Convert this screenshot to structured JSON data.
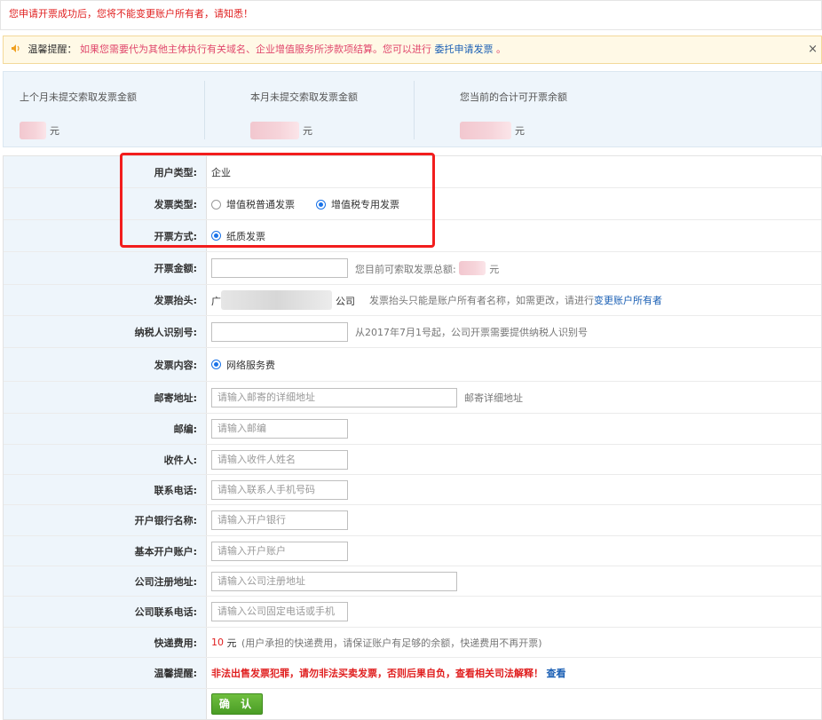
{
  "top_notice": "您申请开票成功后，您将不能变更账户所有者，请知悉！",
  "tip": {
    "title": "温馨提醒：",
    "text": "如果您需要代为其他主体执行有关域名、企业增值服务所涉款项结算。您可以进行",
    "link": "委托申请发票",
    "end": "。",
    "close": "×"
  },
  "summary": {
    "last_month_label": "上个月未提交索取发票金额",
    "this_month_label": "本月未提交索取发票金额",
    "available_label": "您当前的合计可开票余额",
    "unit": "元"
  },
  "form": {
    "user_type": {
      "label": "用户类型:",
      "value": "企业"
    },
    "invoice_type": {
      "label": "发票类型:",
      "options": [
        "增值税普通发票",
        "增值税专用发票"
      ],
      "selected": "增值税专用发票"
    },
    "issue_method": {
      "label": "开票方式:",
      "option": "纸质发票"
    },
    "amount": {
      "label": "开票金额:",
      "hint_prefix": "您目前可索取发票总额:",
      "unit": "元"
    },
    "title": {
      "label": "发票抬头:",
      "value_start": "广",
      "value_end": "公司",
      "hint": "发票抬头只能是账户所有者名称，如需更改，请进行",
      "link": "变更账户所有者"
    },
    "tax_id": {
      "label": "纳税人识别号:",
      "hint": "从2017年7月1号起，公司开票需要提供纳税人识别号"
    },
    "content": {
      "label": "发票内容:",
      "option": "网络服务费"
    },
    "mail_address": {
      "label": "邮寄地址:",
      "placeholder": "请输入邮寄的详细地址",
      "hint": "邮寄详细地址"
    },
    "postcode": {
      "label": "邮编:",
      "placeholder": "请输入邮编"
    },
    "recipient": {
      "label": "收件人:",
      "placeholder": "请输入收件人姓名"
    },
    "phone": {
      "label": "联系电话:",
      "placeholder": "请输入联系人手机号码"
    },
    "bank_name": {
      "label": "开户银行名称:",
      "placeholder": "请输入开户银行"
    },
    "bank_account": {
      "label": "基本开户账户:",
      "placeholder": "请输入开户账户"
    },
    "company_address": {
      "label": "公司注册地址:",
      "placeholder": "请输入公司注册地址"
    },
    "company_phone": {
      "label": "公司联系电话:",
      "placeholder": "请输入公司固定电话或手机"
    },
    "shipping": {
      "label": "快递费用:",
      "amount": "10",
      "unit": "元",
      "note": "(用户承担的快递费用，请保证账户有足够的余额，快递费用不再开票)"
    },
    "warning": {
      "label": "温馨提醒:",
      "text": "非法出售发票犯罪，请勿非法买卖发票，否则后果自负，查看相关司法解释！",
      "link": "查看"
    },
    "confirm": "确 认"
  },
  "colors": {
    "red": "#e01f1f",
    "link": "#1a5fb4",
    "label_bg": "#eef5fb",
    "confirm_green": "#5aaa30"
  }
}
